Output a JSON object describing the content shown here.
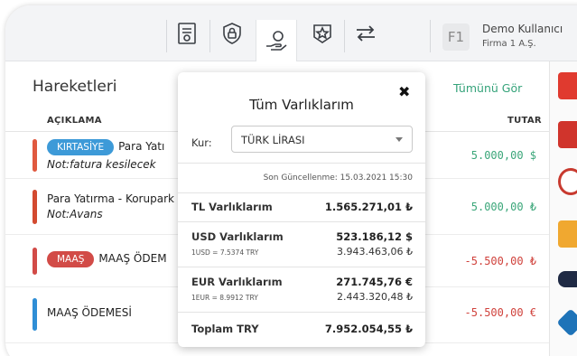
{
  "header": {
    "icons": [
      "invoice-icon",
      "shield-icon",
      "hand-coin-icon",
      "badge-star-icon",
      "transfer-arrows-icon"
    ],
    "company_initials": "F1",
    "user_name": "Demo Kullanıcı",
    "company_name": "Firma 1 A.Ş."
  },
  "transactions": {
    "title": "Hareketleri",
    "see_all": "Tümünü Gör",
    "col_description": "AÇIKLAMA",
    "col_amount": "TUTAR",
    "rows": [
      {
        "badge": "KIRTASİYE",
        "badge_color": "#3d9ad8",
        "text": "Para Yatı",
        "note": "Not:fatura kesilecek",
        "amount": "5.000,00 $",
        "amount_color": "#3aa679",
        "bar_color": "#e0593f"
      },
      {
        "badge": "",
        "text": "Para Yatırma - Korupark",
        "note": "Not:Avans",
        "amount": "5.000,00 ₺",
        "amount_color": "#3aa679",
        "bar_color": "#d34a30"
      },
      {
        "badge": "MAAŞ",
        "badge_color": "#d24b47",
        "text": "MAAŞ ÖDEM",
        "note": "",
        "amount": "-5.500,00 ₺",
        "amount_color": "#d0423c",
        "bar_color": "#d24b47"
      },
      {
        "badge": "",
        "text": "MAAŞ ÖDEMESİ",
        "note": "",
        "amount": "-5.500,00 €",
        "amount_color": "#d0423c",
        "bar_color": "#2f8ed6"
      }
    ]
  },
  "popup": {
    "title": "Tüm Varlıklarım",
    "close": "✖",
    "kur_label": "Kur:",
    "kur_value": "TÜRK LİRASI",
    "updated": "Son Güncellenme: 15.03.2021 15:30",
    "tl_label": "TL Varlıklarım",
    "tl_value": "1.565.271,01 ₺",
    "usd_label": "USD Varlıklarım",
    "usd_rate": "1USD = 7.5374 TRY",
    "usd_value": "523.186,12 $",
    "usd_try": "3.943.463,06 ₺",
    "eur_label": "EUR Varlıklarım",
    "eur_rate": "1EUR = 8.9912 TRY",
    "eur_value": "271.745,76 €",
    "eur_try": "2.443.320,48 ₺",
    "total_label": "Toplam TRY",
    "total_value": "7.952.054,55 ₺"
  },
  "bank_logos": [
    "akbank-logo",
    "ziraat-logo",
    "isbank-logo",
    "vakifbank-logo",
    "yapikredi-logo",
    "halkbank-logo"
  ]
}
